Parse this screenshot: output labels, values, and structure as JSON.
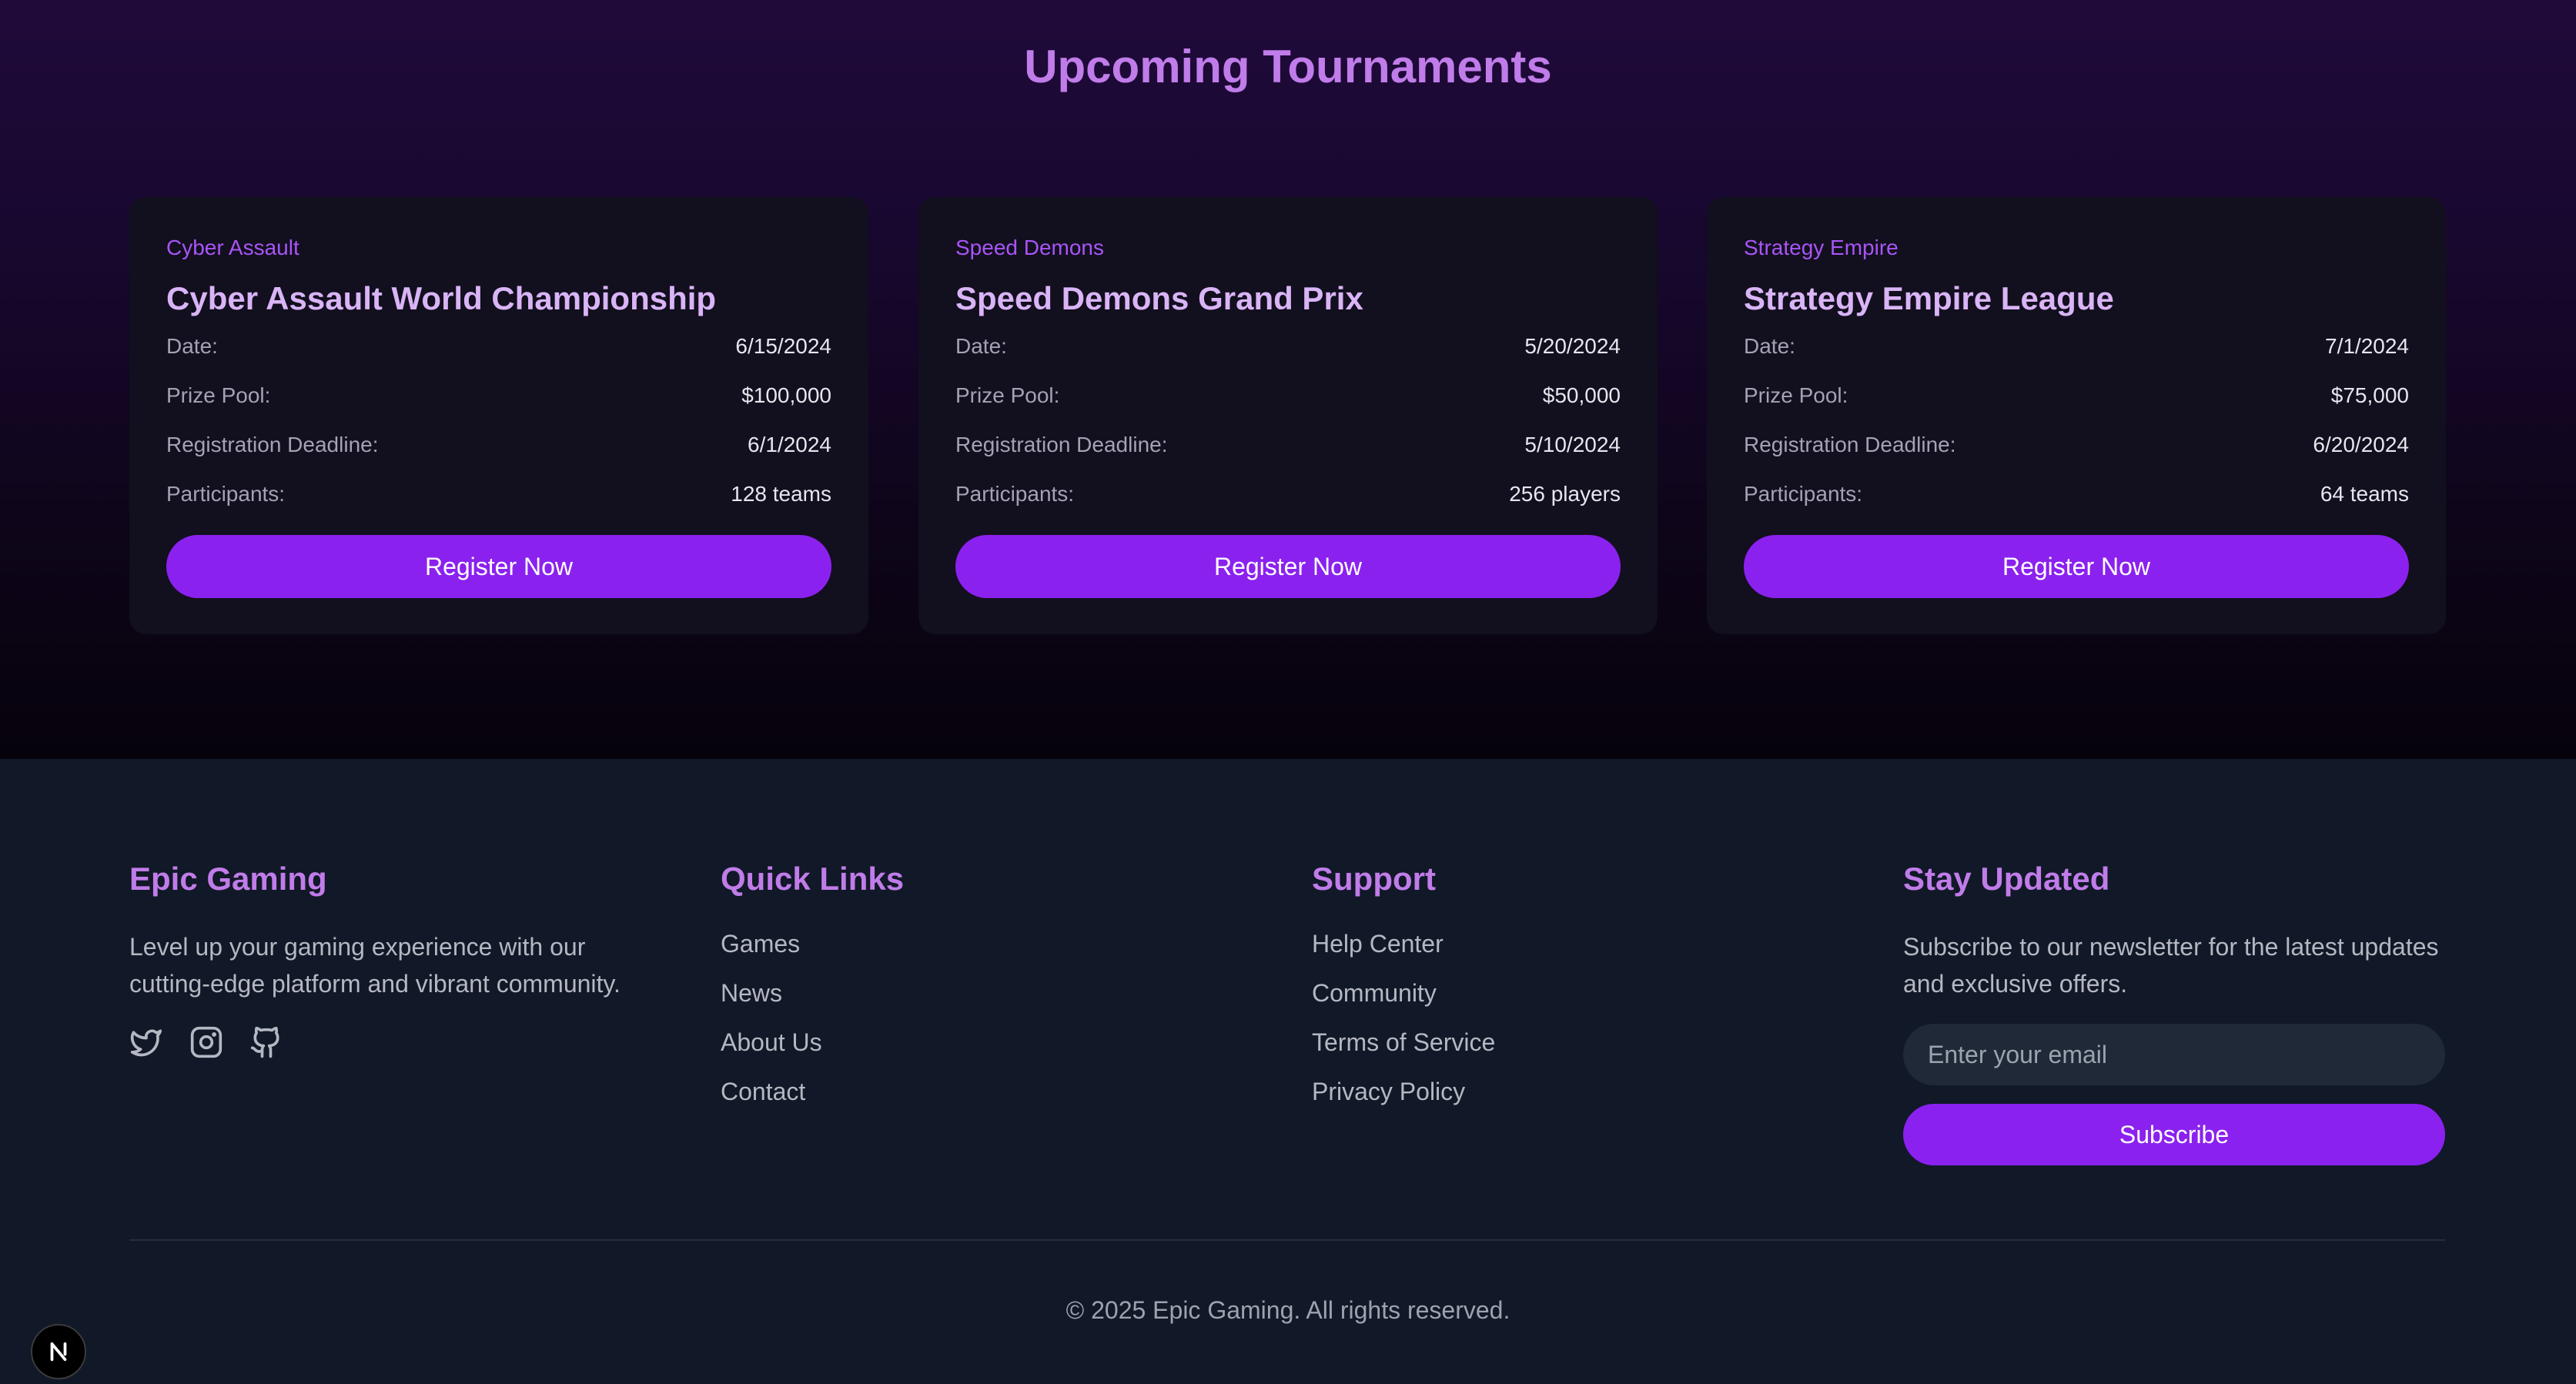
{
  "section": {
    "title": "Upcoming Tournaments"
  },
  "tournaments": [
    {
      "game": "Cyber Assault",
      "name": "Cyber Assault World Championship",
      "rows": [
        {
          "label": "Date:",
          "value": "6/15/2024"
        },
        {
          "label": "Prize Pool:",
          "value": "$100,000"
        },
        {
          "label": "Registration Deadline:",
          "value": "6/1/2024"
        },
        {
          "label": "Participants:",
          "value": "128 teams"
        }
      ],
      "button": "Register Now"
    },
    {
      "game": "Speed Demons",
      "name": "Speed Demons Grand Prix",
      "rows": [
        {
          "label": "Date:",
          "value": "5/20/2024"
        },
        {
          "label": "Prize Pool:",
          "value": "$50,000"
        },
        {
          "label": "Registration Deadline:",
          "value": "5/10/2024"
        },
        {
          "label": "Participants:",
          "value": "256 players"
        }
      ],
      "button": "Register Now"
    },
    {
      "game": "Strategy Empire",
      "name": "Strategy Empire League",
      "rows": [
        {
          "label": "Date:",
          "value": "7/1/2024"
        },
        {
          "label": "Prize Pool:",
          "value": "$75,000"
        },
        {
          "label": "Registration Deadline:",
          "value": "6/20/2024"
        },
        {
          "label": "Participants:",
          "value": "64 teams"
        }
      ],
      "button": "Register Now"
    }
  ],
  "footer": {
    "brand": {
      "title": "Epic Gaming",
      "description": "Level up your gaming experience with our cutting-edge platform and vibrant community.",
      "social_icons": [
        "twitter-icon",
        "instagram-icon",
        "github-icon"
      ]
    },
    "quick_links": {
      "title": "Quick Links",
      "items": [
        "Games",
        "News",
        "About Us",
        "Contact"
      ]
    },
    "support": {
      "title": "Support",
      "items": [
        "Help Center",
        "Community",
        "Terms of Service",
        "Privacy Policy"
      ]
    },
    "newsletter": {
      "title": "Stay Updated",
      "description": "Subscribe to our newsletter for the latest updates and exclusive offers.",
      "placeholder": "Enter your email",
      "button": "Subscribe"
    },
    "copyright": "© 2025 Epic Gaming. All rights reserved."
  },
  "colors": {
    "accent": "#8b21ef",
    "heading": "#c07ce9",
    "footer_bg": "#111827"
  }
}
